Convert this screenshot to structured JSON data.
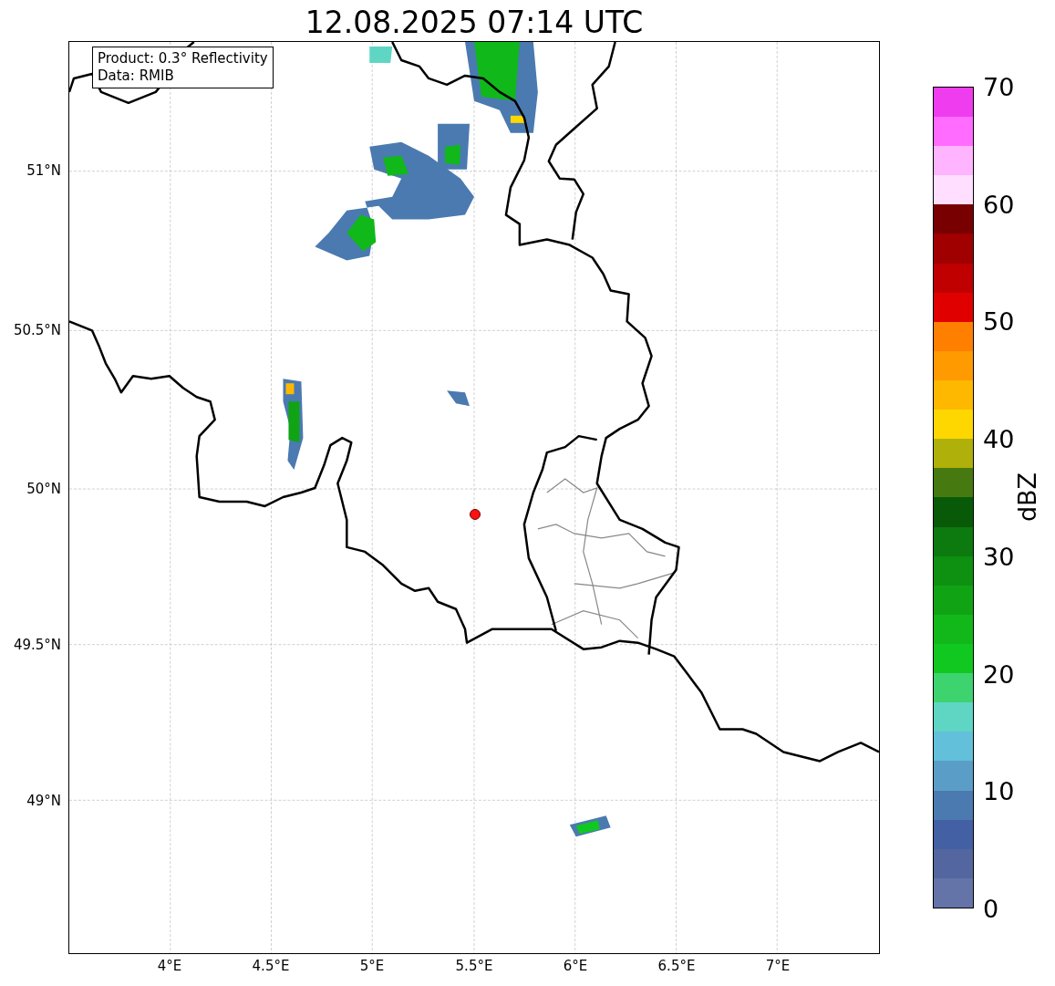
{
  "title": "12.08.2025 07:14 UTC",
  "annotation": [
    "Product: 0.3° Reflectivity",
    "Data: RMIB"
  ],
  "map": {
    "xticks": [
      "4°E",
      "4.5°E",
      "5°E",
      "5.5°E",
      "6°E",
      "6.5°E",
      "7°E"
    ],
    "yticks": [
      "51°N",
      "50.5°N",
      "50°N",
      "49.5°N",
      "49°N"
    ]
  },
  "colorbar": {
    "label": "dBZ",
    "ticks": [
      "70",
      "60",
      "50",
      "40",
      "30",
      "20",
      "10",
      "0"
    ],
    "segments": [
      {
        "color": "#6474a8"
      },
      {
        "color": "#5366a0"
      },
      {
        "color": "#4460a4"
      },
      {
        "color": "#4a7ab0"
      },
      {
        "color": "#5a9ec8"
      },
      {
        "color": "#62c0da"
      },
      {
        "color": "#5fd6c4"
      },
      {
        "color": "#3dd470"
      },
      {
        "color": "#10c820"
      },
      {
        "color": "#12b81a"
      },
      {
        "color": "#10a414"
      },
      {
        "color": "#0e9010"
      },
      {
        "color": "#0c7a0e"
      },
      {
        "color": "#085a08"
      },
      {
        "color": "#467a10"
      },
      {
        "color": "#b0b00a"
      },
      {
        "color": "#ffd700"
      },
      {
        "color": "#ffb800"
      },
      {
        "color": "#ff9a00"
      },
      {
        "color": "#ff7f00"
      },
      {
        "color": "#e00000"
      },
      {
        "color": "#c00000"
      },
      {
        "color": "#a00000"
      },
      {
        "color": "#780000"
      },
      {
        "color": "#ffdeff"
      },
      {
        "color": "#ffb4ff"
      },
      {
        "color": "#ff6cff"
      },
      {
        "color": "#ee3cee"
      }
    ]
  }
}
